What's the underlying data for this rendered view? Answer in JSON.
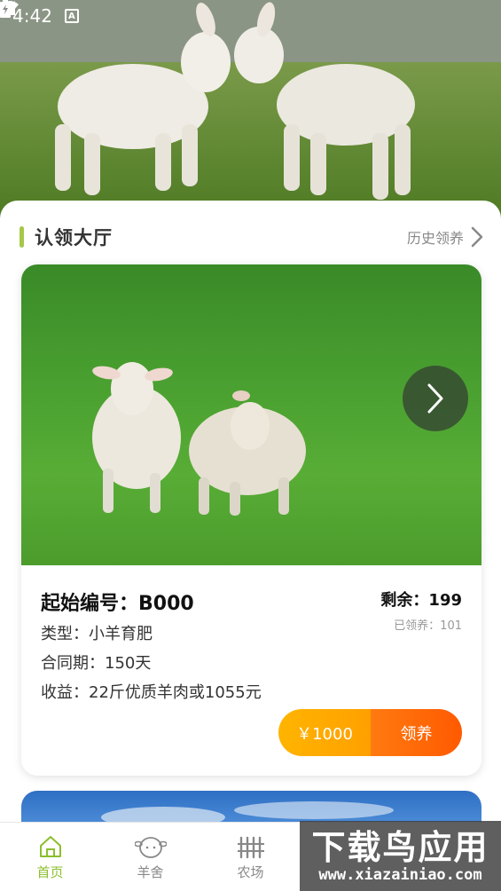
{
  "status_bar": {
    "time": "4:42",
    "notification_icon_letter": "A"
  },
  "header": {
    "title": "认领大厅",
    "history_label": "历史领养"
  },
  "card": {
    "code": "起始编号：B000",
    "remaining": "剩余：199",
    "adopted": "已领养：101",
    "type": "类型：小羊育肥",
    "period": "合同期：150天",
    "income": "收益：22斤优质羊肉或1055元",
    "price_label": "￥1000",
    "adopt_label": "领养"
  },
  "bottom_nav": [
    {
      "label": "首页",
      "icon": "home-icon",
      "active": true
    },
    {
      "label": "羊舍",
      "icon": "sheep-icon",
      "active": false
    },
    {
      "label": "农场",
      "icon": "fence-icon",
      "active": false
    }
  ],
  "watermark": {
    "main": "下载鸟应用",
    "sub": "www.xiazainiao.com"
  },
  "colors": {
    "accent_green": "#8cbf2e",
    "price_orange": "#ffa800",
    "adopt_orange": "#ff6a00"
  }
}
